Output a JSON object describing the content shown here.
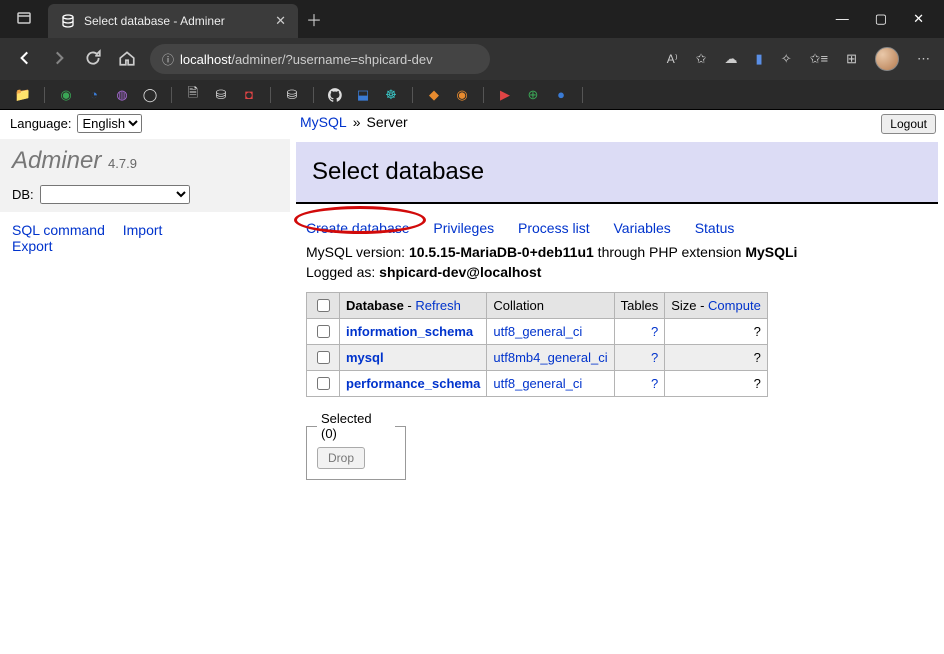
{
  "browser": {
    "tab_title": "Select database - Adminer",
    "url_host": "localhost",
    "url_path": "/adminer/?username=shpicard-dev"
  },
  "sidebar": {
    "language_label": "Language:",
    "language_value": "English",
    "logo": "Adminer",
    "version": "4.7.9",
    "db_label": "DB:",
    "db_value": "",
    "links": {
      "sql_command": "SQL command",
      "import": "Import",
      "export": "Export"
    }
  },
  "breadcrumb": {
    "engine": "MySQL",
    "separator": "»",
    "server": "Server"
  },
  "logout_label": "Logout",
  "page_title": "Select database",
  "actions": {
    "create_database": "Create database",
    "privileges": "Privileges",
    "process_list": "Process list",
    "variables": "Variables",
    "status": "Status"
  },
  "info": {
    "version_label": "MySQL version: ",
    "version_value": "10.5.15-MariaDB-0+deb11u1",
    "version_suffix": " through PHP extension ",
    "extension": "MySQLi",
    "logged_label": "Logged as: ",
    "logged_value": "shpicard-dev@localhost"
  },
  "table": {
    "headers": {
      "database": "Database",
      "refresh": "Refresh",
      "collation": "Collation",
      "tables": "Tables",
      "size": "Size",
      "compute": "Compute"
    },
    "rows": [
      {
        "name": "information_schema",
        "collation": "utf8_general_ci",
        "tables": "?",
        "size": "?"
      },
      {
        "name": "mysql",
        "collation": "utf8mb4_general_ci",
        "tables": "?",
        "size": "?"
      },
      {
        "name": "performance_schema",
        "collation": "utf8_general_ci",
        "tables": "?",
        "size": "?"
      }
    ]
  },
  "fieldset": {
    "legend": "Selected (0)",
    "drop": "Drop"
  }
}
